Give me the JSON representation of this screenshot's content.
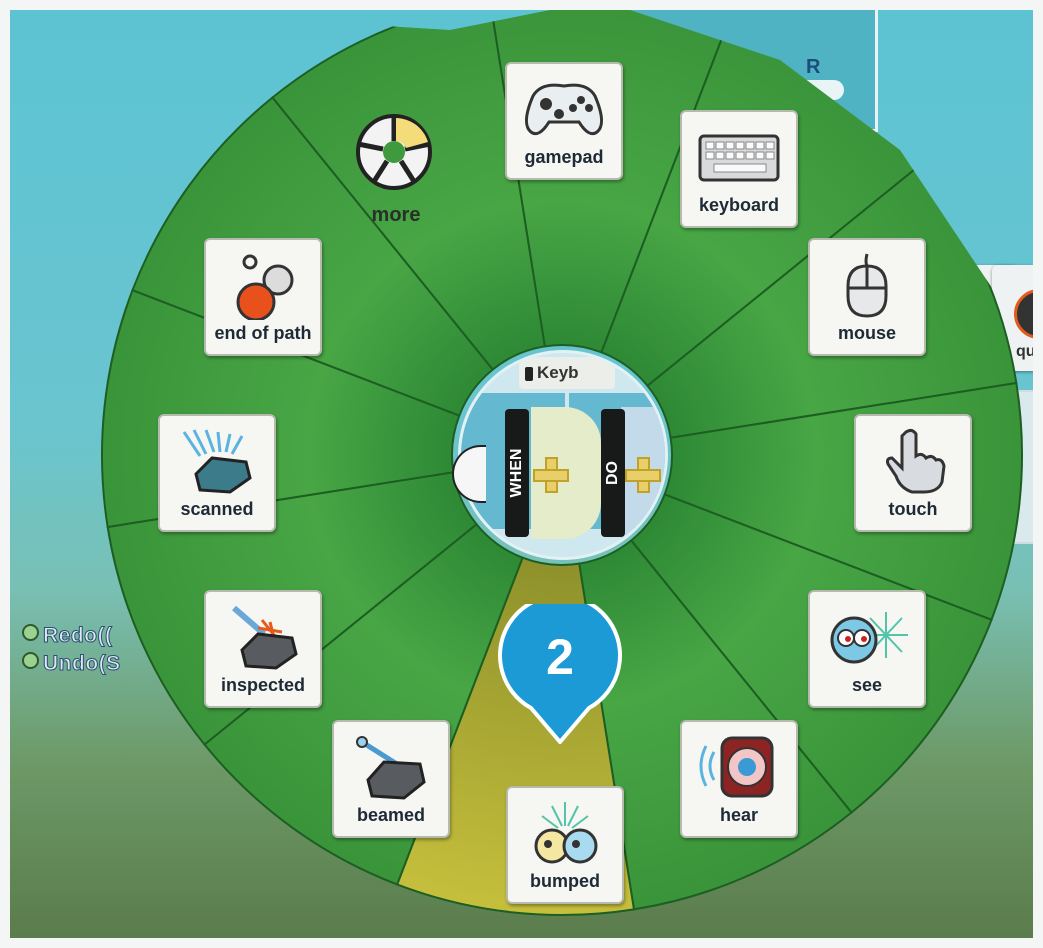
{
  "background": {
    "tile_partial_label": "qu",
    "menu": [
      {
        "label": "Redo(("
      },
      {
        "label": "Undo(S"
      }
    ],
    "top_panel_text": "R"
  },
  "hub": {
    "top_label": "Keyb",
    "when_label": "WHEN",
    "do_label": "DO"
  },
  "selection_marker": {
    "number": "2"
  },
  "tiles": {
    "gamepad": "gamepad",
    "keyboard": "keyboard",
    "mouse": "mouse",
    "touch": "touch",
    "see": "see",
    "hear": "hear",
    "bumped": "bumped",
    "beamed": "beamed",
    "inspected": "inspected",
    "scanned": "scanned",
    "end_of_path": "end of path",
    "more": "more"
  },
  "colors": {
    "pie_green": "#3e9a3c",
    "pie_highlight": "#b4b43a",
    "marker_blue": "#1b9ad6"
  }
}
